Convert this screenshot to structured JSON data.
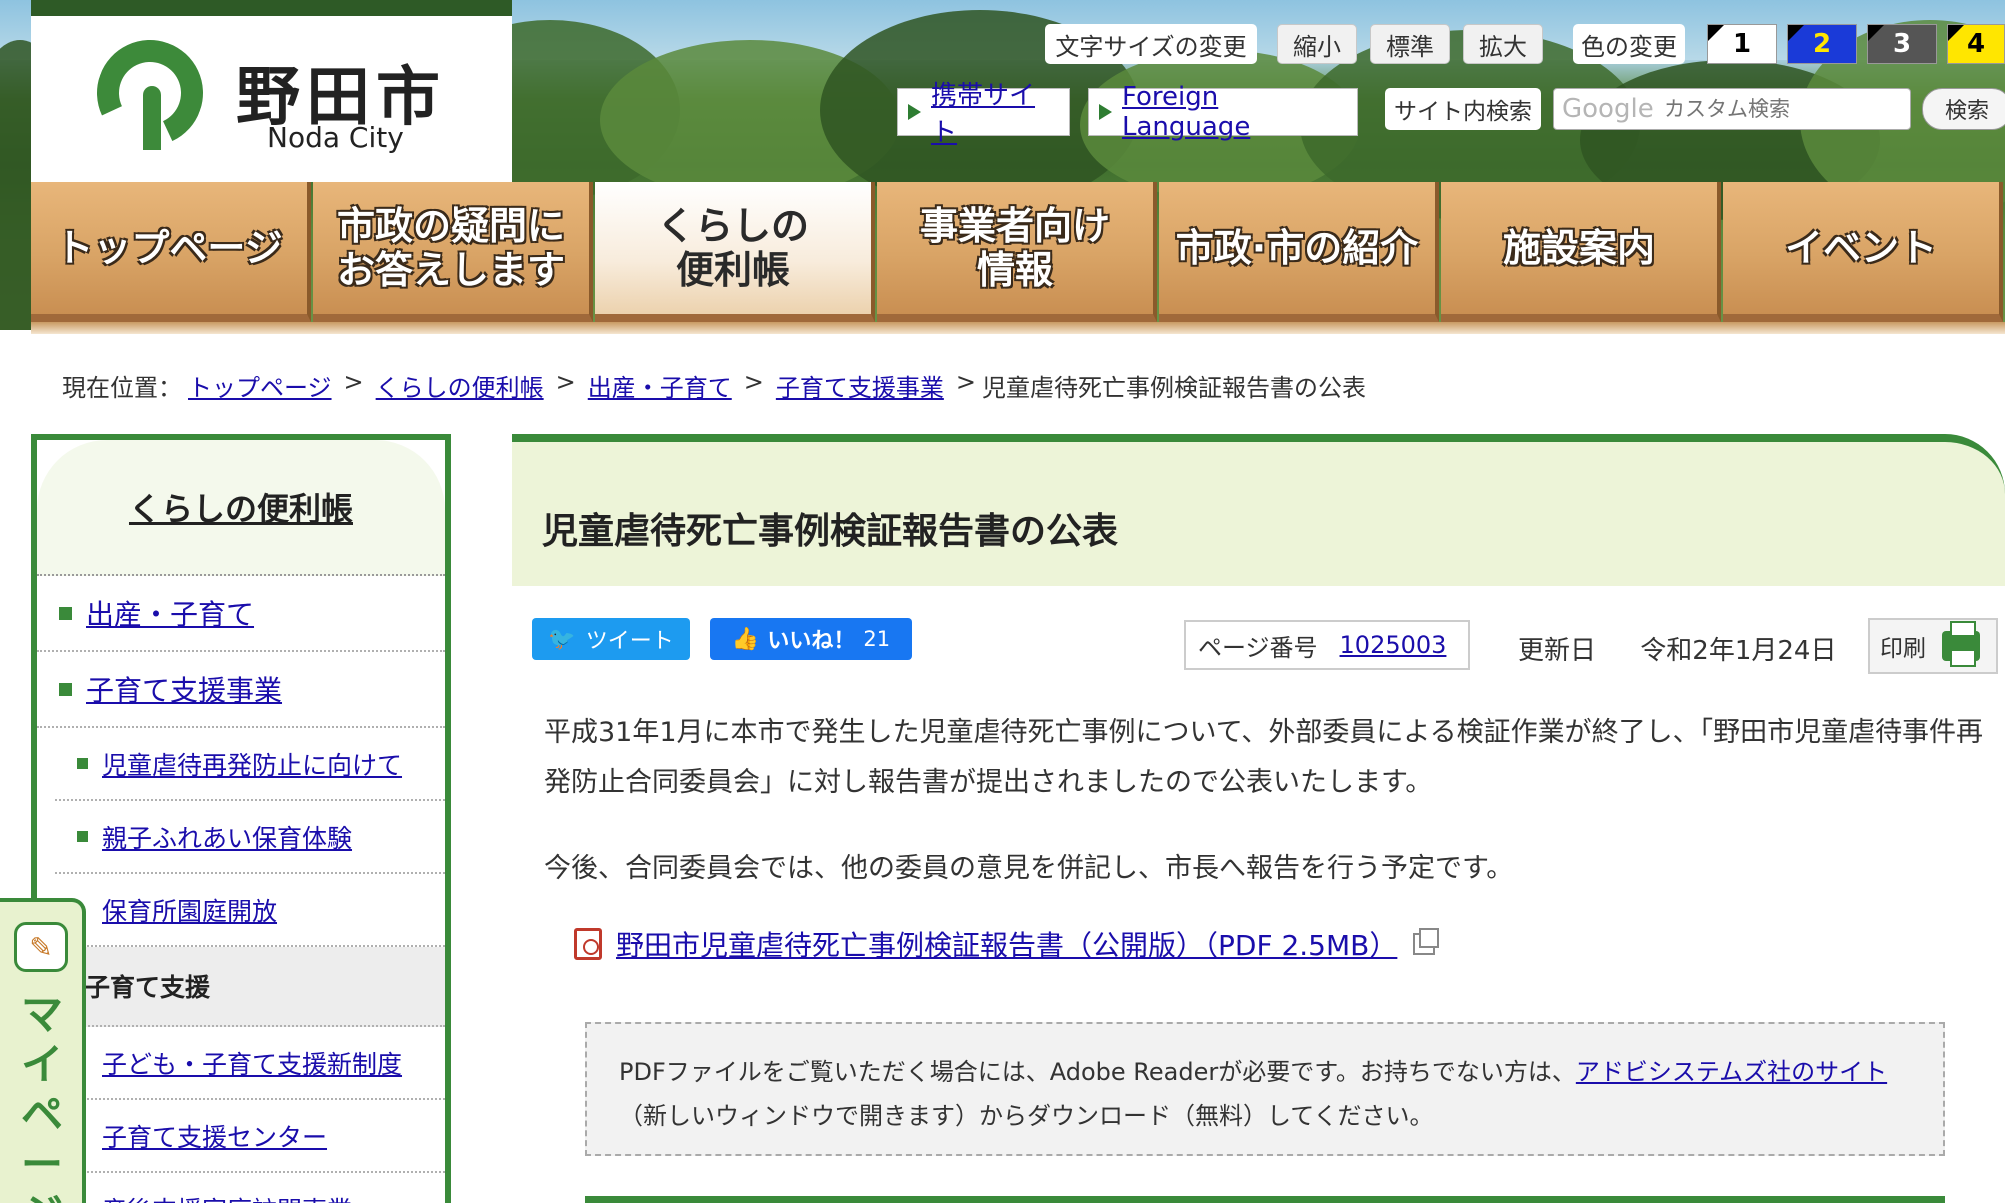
{
  "header": {
    "logo_jp": "野田市",
    "logo_en": "Noda City",
    "font_size_label": "文字サイズの変更",
    "font_small": "縮小",
    "font_normal": "標準",
    "font_large": "拡大",
    "color_label": "色の変更",
    "color_options": [
      {
        "label": "1",
        "bg": "#ffffff",
        "fg": "#000000"
      },
      {
        "label": "2",
        "bg": "#1a3ad8",
        "fg": "#ffe600"
      },
      {
        "label": "3",
        "bg": "#555555",
        "fg": "#ffffff"
      },
      {
        "label": "4",
        "bg": "#ffe600",
        "fg": "#000000"
      }
    ],
    "mobile_link": "携帯サイト",
    "foreign_link": "Foreign Language",
    "search_label": "サイト内検索",
    "search_google": "Google",
    "search_placeholder": "カスタム検索",
    "search_button": "検索"
  },
  "nav": [
    "トップページ",
    "市政の疑問に\nお答えします",
    "くらしの\n便利帳",
    "事業者向け\n情報",
    "市政·市の紹介",
    "施設案内",
    "イベント"
  ],
  "breadcrumb": {
    "prefix": "現在位置：",
    "links": [
      "トップページ",
      "くらしの便利帳",
      "出産・子育て",
      "子育て支援事業"
    ],
    "current": "児童虐待死亡事例検証報告書の公表",
    "separator": ">"
  },
  "sidebar": {
    "title": "くらしの便利帳",
    "items": [
      "出産・子育て",
      "子育て支援事業"
    ],
    "subitems": [
      "児童虐待再発防止に向けて",
      "親子ふれあい保育体験",
      "保育所園庭開放"
    ],
    "section": "子育て支援",
    "section_items": [
      "子ども・子育て支援新制度",
      "子育て支援センター",
      "産後支援家庭訪問事業"
    ]
  },
  "mypage": {
    "label": "マイページ"
  },
  "main": {
    "title": "児童虐待死亡事例検証報告書の公表",
    "tweet": "ツイート",
    "like": "いいね！",
    "like_count": "21",
    "page_number_label": "ページ番号",
    "page_number": "1025003",
    "updated_label": "更新日",
    "updated_date": "令和2年1月24日",
    "print": "印刷",
    "para1": "平成31年1月に本市で発生した児童虐待死亡事例について、外部委員による検証作業が終了し、「野田市児童虐待事件再発防止合同委員会」に対し報告書が提出されましたので公表いたします。",
    "para2": "今後、合同委員会では、他の委員の意見を併記し、市長へ報告を行う予定です。",
    "pdf_link": "野田市児童虐待死亡事例検証報告書（公開版）（PDF 2.5MB）",
    "notice_text1": "PDFファイルをご覧いただく場合には、Adobe Readerが必要です。お持ちでない方は、",
    "notice_link": "アドビシステムズ社のサイト",
    "notice_text2": "（新しいウィンドウで開きます）からダウンロード（無料）してください。"
  },
  "colors": {
    "brand_green": "#3a8a3a",
    "link": "#1a0dab",
    "nav_wood": "#d9a466"
  }
}
